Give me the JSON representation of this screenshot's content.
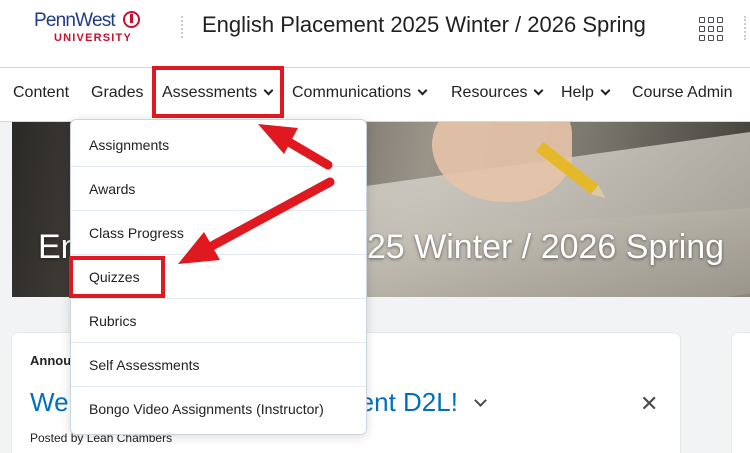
{
  "header": {
    "logo_main": "PennWest",
    "logo_sub": "UNIVERSITY",
    "course_title": "English Placement 2025 Winter / 2026 Spring",
    "apps_icon": "waffle-grid-icon"
  },
  "nav": {
    "items": [
      {
        "label": "Content",
        "has_menu": false
      },
      {
        "label": "Grades",
        "has_menu": false
      },
      {
        "label": "Assessments",
        "has_menu": true
      },
      {
        "label": "Communications",
        "has_menu": true
      },
      {
        "label": "Resources",
        "has_menu": true
      },
      {
        "label": "Help",
        "has_menu": true
      },
      {
        "label": "Course Admin",
        "has_menu": false
      }
    ]
  },
  "banner": {
    "title": "English Placement 2025 Winter / 2026 Spring"
  },
  "assessments_menu": {
    "items": [
      {
        "label": "Assignments"
      },
      {
        "label": "Awards"
      },
      {
        "label": "Class Progress"
      },
      {
        "label": "Quizzes"
      },
      {
        "label": "Rubrics"
      },
      {
        "label": "Self Assessments"
      },
      {
        "label": "Bongo Video Assignments (Instructor)"
      }
    ]
  },
  "announcements": {
    "heading": "Announcements",
    "title": "Welcome to English Placement D2L!",
    "title_visible_start": "We",
    "title_visible_end": "ement D2L!",
    "posted_by": "Posted by Leah Chambers",
    "close_glyph": "✕"
  },
  "colors": {
    "accent_link": "#006fbf",
    "highlight": "#e0181f",
    "logo_blue": "#1f3c88",
    "logo_red": "#c8102e"
  }
}
